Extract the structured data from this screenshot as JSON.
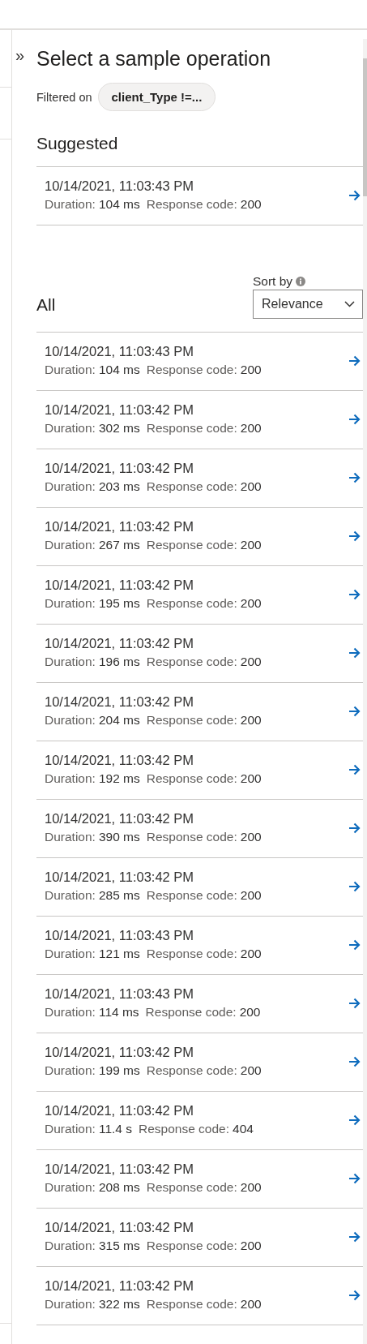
{
  "panel": {
    "collapse_button": "»",
    "title": "Select a sample operation",
    "filter_label": "Filtered on",
    "filter_chip": "client_Type !=...",
    "suggested": {
      "heading": "Suggested",
      "rows": [
        {
          "date": "10/14/2021, 11:03:43 PM",
          "duration_label": "Duration:",
          "duration": "104 ms",
          "code_label": "Response code:",
          "code": "200"
        }
      ]
    },
    "all": {
      "heading": "All",
      "sort_label": "Sort by",
      "sort_value": "Relevance",
      "rows": [
        {
          "date": "10/14/2021, 11:03:43 PM",
          "duration_label": "Duration:",
          "duration": "104 ms",
          "code_label": "Response code:",
          "code": "200"
        },
        {
          "date": "10/14/2021, 11:03:42 PM",
          "duration_label": "Duration:",
          "duration": "302 ms",
          "code_label": "Response code:",
          "code": "200"
        },
        {
          "date": "10/14/2021, 11:03:42 PM",
          "duration_label": "Duration:",
          "duration": "203 ms",
          "code_label": "Response code:",
          "code": "200"
        },
        {
          "date": "10/14/2021, 11:03:42 PM",
          "duration_label": "Duration:",
          "duration": "267 ms",
          "code_label": "Response code:",
          "code": "200"
        },
        {
          "date": "10/14/2021, 11:03:42 PM",
          "duration_label": "Duration:",
          "duration": "195 ms",
          "code_label": "Response code:",
          "code": "200"
        },
        {
          "date": "10/14/2021, 11:03:42 PM",
          "duration_label": "Duration:",
          "duration": "196 ms",
          "code_label": "Response code:",
          "code": "200"
        },
        {
          "date": "10/14/2021, 11:03:42 PM",
          "duration_label": "Duration:",
          "duration": "204 ms",
          "code_label": "Response code:",
          "code": "200"
        },
        {
          "date": "10/14/2021, 11:03:42 PM",
          "duration_label": "Duration:",
          "duration": "192 ms",
          "code_label": "Response code:",
          "code": "200"
        },
        {
          "date": "10/14/2021, 11:03:42 PM",
          "duration_label": "Duration:",
          "duration": "390 ms",
          "code_label": "Response code:",
          "code": "200"
        },
        {
          "date": "10/14/2021, 11:03:42 PM",
          "duration_label": "Duration:",
          "duration": "285 ms",
          "code_label": "Response code:",
          "code": "200"
        },
        {
          "date": "10/14/2021, 11:03:43 PM",
          "duration_label": "Duration:",
          "duration": "121 ms",
          "code_label": "Response code:",
          "code": "200"
        },
        {
          "date": "10/14/2021, 11:03:43 PM",
          "duration_label": "Duration:",
          "duration": "114 ms",
          "code_label": "Response code:",
          "code": "200"
        },
        {
          "date": "10/14/2021, 11:03:42 PM",
          "duration_label": "Duration:",
          "duration": "199 ms",
          "code_label": "Response code:",
          "code": "200"
        },
        {
          "date": "10/14/2021, 11:03:42 PM",
          "duration_label": "Duration:",
          "duration": "11.4 s",
          "code_label": "Response code:",
          "code": "404"
        },
        {
          "date": "10/14/2021, 11:03:42 PM",
          "duration_label": "Duration:",
          "duration": "208 ms",
          "code_label": "Response code:",
          "code": "200"
        },
        {
          "date": "10/14/2021, 11:03:42 PM",
          "duration_label": "Duration:",
          "duration": "315 ms",
          "code_label": "Response code:",
          "code": "200"
        },
        {
          "date": "10/14/2021, 11:03:42 PM",
          "duration_label": "Duration:",
          "duration": "322 ms",
          "code_label": "Response code:",
          "code": "200"
        }
      ]
    }
  }
}
